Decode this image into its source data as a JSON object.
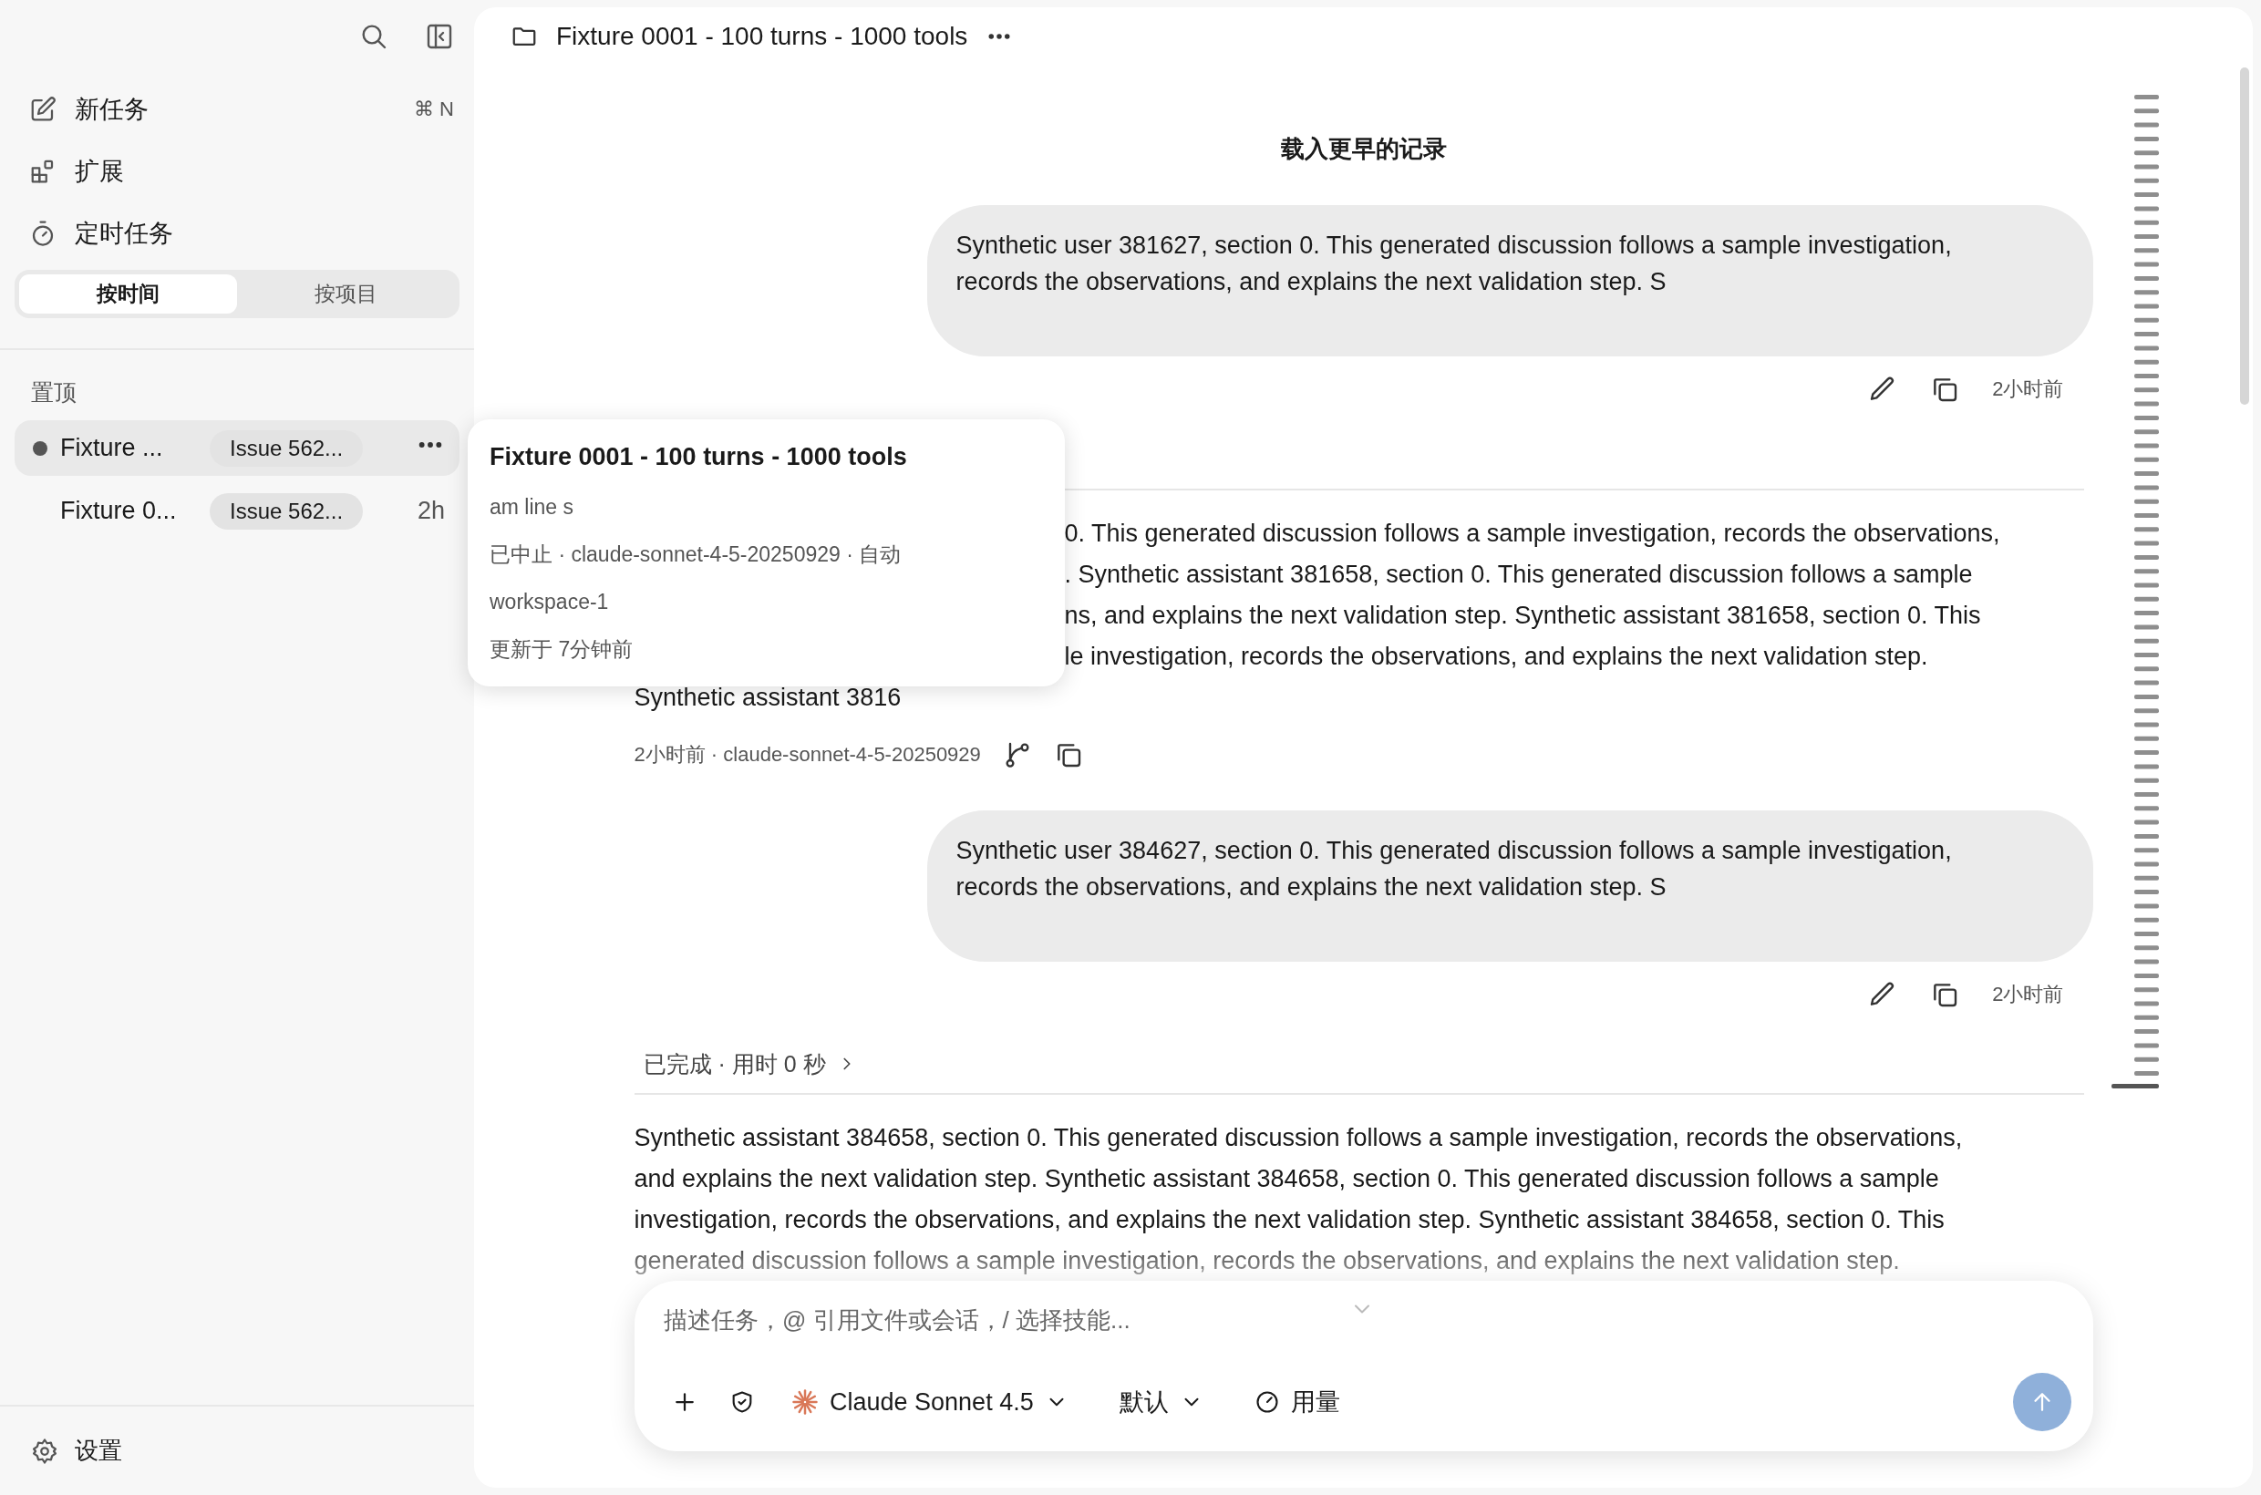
{
  "sidebar": {
    "nav": [
      {
        "kind": "new-task",
        "label": "新任务",
        "shortcut": "⌘ N"
      },
      {
        "kind": "extensions",
        "label": "扩展"
      },
      {
        "kind": "scheduled",
        "label": "定时任务"
      }
    ],
    "view_tabs": [
      {
        "label": "按时间",
        "selected": true
      },
      {
        "label": "按项目",
        "selected": false
      }
    ],
    "section_title": "置顶",
    "tasks": [
      {
        "title": "Fixture ...",
        "tag": "Issue 562...",
        "selected": true,
        "dot": true,
        "hovered": true
      },
      {
        "title": "Fixture 0...",
        "tag": "Issue 562...",
        "time": "2h",
        "selected": false,
        "dot": false,
        "hovered": false
      }
    ],
    "settings": "设置"
  },
  "header": {
    "title": "Fixture 0001 - 100 turns - 1000 tools"
  },
  "load_earlier": "载入更早的记录",
  "messages": [
    {
      "kind": "user",
      "lines": [
        "Synthetic user 381627, section 0. This generated discussion follows a sample investigation,",
        "records the observations, and explains the next validation step. S"
      ],
      "time": "2小时前"
    },
    {
      "kind": "assistant",
      "partial_lines": [
        "0. This generated discussion follows a sample investigation, records the observations,",
        ". Synthetic assistant 381658, section 0. This generated discussion follows a sample",
        "ns, and explains the next validation step. Synthetic assistant 381658, section 0. This",
        "le investigation, records the observations, and explains the next validation step."
      ],
      "lines": [
        "Synthetic assistant 3816"
      ],
      "meta": "2小时前 · claude-sonnet-4-5-20250929"
    },
    {
      "kind": "user",
      "lines": [
        "Synthetic user 384627, section 0. This generated discussion follows a sample investigation,",
        "records the observations, and explains the next validation step. S"
      ],
      "time": "2小时前"
    },
    {
      "kind": "assistant",
      "status": "已完成 · 用时 0 秒",
      "lines": [
        "Synthetic assistant 384658, section 0. This generated discussion follows a sample investigation, records the observations,",
        "and explains the next validation step. Synthetic assistant 384658, section 0. This generated discussion follows a sample",
        "investigation, records the observations, and explains the next validation step. Synthetic assistant 384658, section 0. This",
        "generated discussion follows a sample investigation, records the observations, and explains the next validation step."
      ]
    }
  ],
  "composer": {
    "placeholder": "描述任务，@ 引用文件或会话，/ 选择技能...",
    "model": "Claude Sonnet 4.5",
    "mode": "默认",
    "usage": "用量"
  },
  "tooltip": {
    "title": "Fixture 0001 - 100 turns - 1000 tools",
    "lines": [
      "am line s",
      "已中止 · claude-sonnet-4-5-20250929 · 自动",
      "workspace-1",
      "更新于 7分钟前"
    ]
  }
}
